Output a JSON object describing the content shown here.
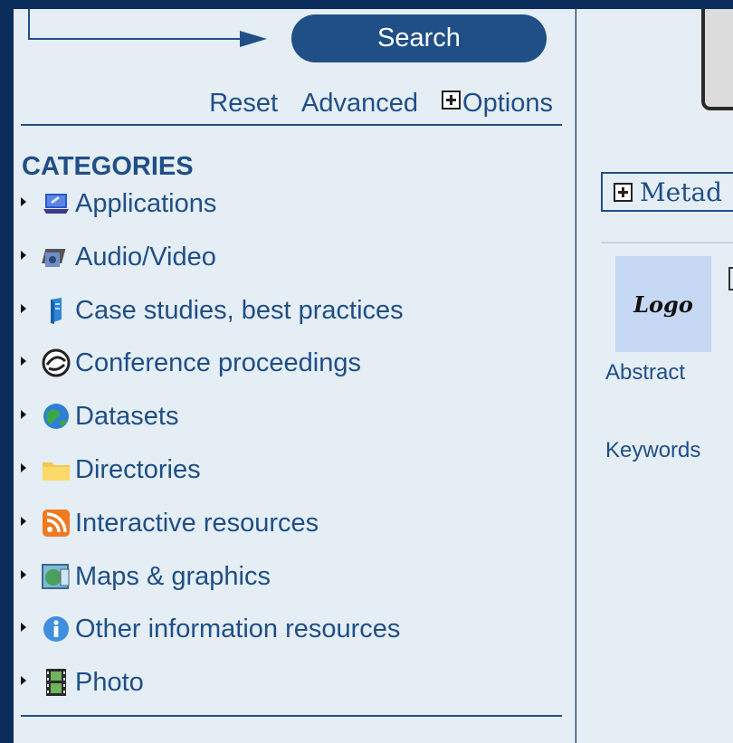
{
  "search": {
    "button_label": "Search"
  },
  "links": {
    "reset": "Reset",
    "advanced": "Advanced",
    "options": "Options"
  },
  "categories": {
    "title": "CATEGORIES",
    "items": [
      {
        "label": "Applications",
        "icon": "applications-icon"
      },
      {
        "label": "Audio/Video",
        "icon": "audio-video-icon"
      },
      {
        "label": "Case studies, best practices",
        "icon": "case-studies-icon"
      },
      {
        "label": "Conference proceedings",
        "icon": "conference-icon"
      },
      {
        "label": "Datasets",
        "icon": "globe-icon"
      },
      {
        "label": "Directories",
        "icon": "folder-icon"
      },
      {
        "label": "Interactive resources",
        "icon": "rss-icon"
      },
      {
        "label": "Maps & graphics",
        "icon": "map-icon"
      },
      {
        "label": "Other information resources",
        "icon": "info-icon"
      },
      {
        "label": "Photo",
        "icon": "film-icon"
      }
    ]
  },
  "record": {
    "metadata_toggle": "Metad",
    "logo_text": "Logo",
    "abstract_label": "Abstract",
    "keywords_label": "Keywords"
  },
  "colors": {
    "brand": "#1f4f86",
    "panel_bg": "#e5edf5",
    "frame_bg": "#0b2d5c",
    "logo_bg": "#c7d8f4"
  }
}
